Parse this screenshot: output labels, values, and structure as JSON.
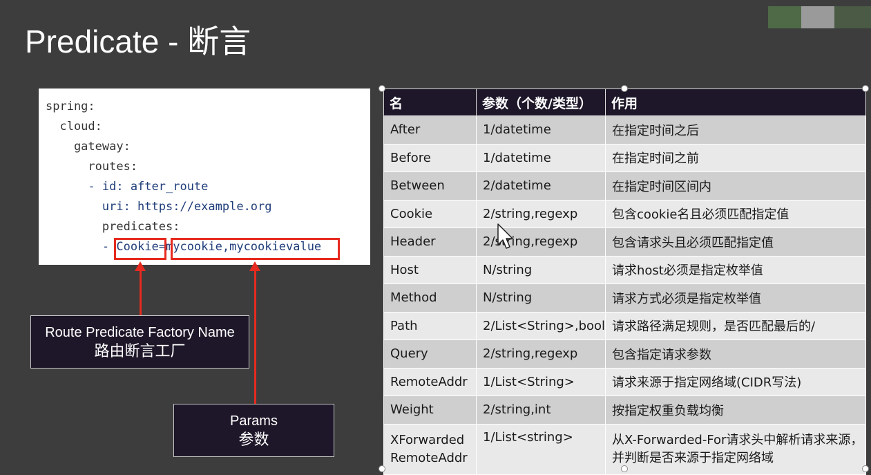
{
  "slide": {
    "title": "Predicate - 断言"
  },
  "thumbs": {
    "colors": [
      "#4f6a47",
      "#9a9a9a",
      "#4a5a45"
    ]
  },
  "code": {
    "lines": [
      "spring:",
      "  cloud:",
      "    gateway:",
      "      routes:",
      "      - id: after_route",
      "        uri: https://example.org",
      "        predicates:",
      "        - Cookie=mycookie,mycookievalue"
    ],
    "highlight_name": "Cookie",
    "highlight_params": "mycookie,mycookievalue"
  },
  "callouts": {
    "factory": {
      "en": "Route Predicate Factory Name",
      "zh": "路由断言工厂"
    },
    "params": {
      "en": "Params",
      "zh": "参数"
    }
  },
  "table": {
    "headers": [
      "名",
      "参数（个数/类型）",
      "作用"
    ],
    "rows": [
      [
        "After",
        "1/datetime",
        "在指定时间之后"
      ],
      [
        "Before",
        "1/datetime",
        "在指定时间之前"
      ],
      [
        "Between",
        "2/datetime",
        "在指定时间区间内"
      ],
      [
        "Cookie",
        "2/string,regexp",
        "包含cookie名且必须匹配指定值"
      ],
      [
        "Header",
        "2/string,regexp",
        "包含请求头且必须匹配指定值"
      ],
      [
        "Host",
        "N/string",
        "请求host必须是指定枚举值"
      ],
      [
        "Method",
        "N/string",
        "请求方式必须是指定枚举值"
      ],
      [
        "Path",
        "2/List<String>,bool",
        "请求路径满足规则，是否匹配最后的/"
      ],
      [
        "Query",
        "2/string,regexp",
        "包含指定请求参数"
      ],
      [
        "RemoteAddr",
        "1/List<String>",
        "请求来源于指定网络域(CIDR写法)"
      ],
      [
        "Weight",
        "2/string,int",
        "按指定权重负载均衡"
      ],
      [
        "XForwarded RemoteAddr",
        "1/List<string>",
        "从X-Forwarded-For请求头中解析请求来源，并判断是否来源于指定网络域"
      ]
    ]
  }
}
